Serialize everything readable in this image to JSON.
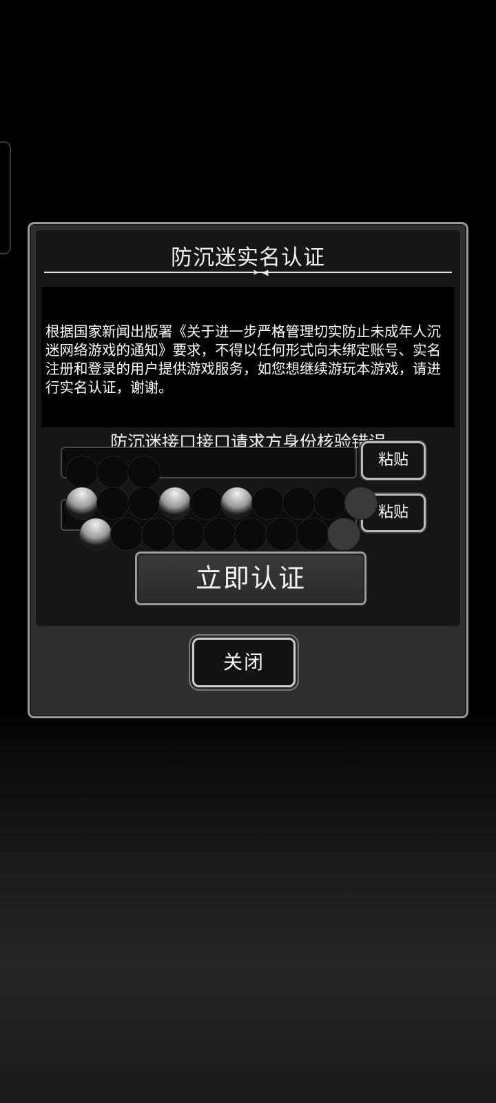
{
  "dialog": {
    "title": "防沉迷实名认证",
    "notice": "根据国家新闻出版署《关于进一步严格管理切实防止未成年人沉迷网络游戏的通知》要求，不得以任何形式向未绑定账号、实名注册和登录的用户提供游戏服务，如您想继续游玩本游戏，请进行实名认证，谢谢。",
    "error_message": "防沉迷接口接口请求方身份核验错误",
    "name_field": {
      "value": "",
      "paste_label": "粘贴"
    },
    "id_field": {
      "value": "",
      "paste_label": "粘贴"
    },
    "verify_label": "立即认证",
    "close_label": "关闭"
  },
  "colors": {
    "background": "#000000",
    "dialog_fill": "#2e2e2e",
    "dialog_border": "#9a9a9a",
    "text": "#ffffff"
  }
}
